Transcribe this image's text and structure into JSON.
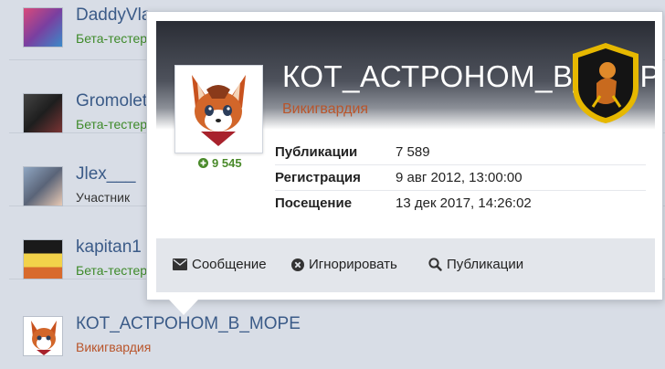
{
  "members": [
    {
      "name": "DaddyVla",
      "rank": "Бета-тестер",
      "rank_type": "beta"
    },
    {
      "name": "Gromolet",
      "rank": "Бета-тестер",
      "rank_type": "beta"
    },
    {
      "name": "Jlex___",
      "rank": "Участник",
      "rank_type": "member"
    },
    {
      "name": "kapitan1",
      "rank": "Бета-тестер",
      "rank_type": "beta"
    },
    {
      "name": "КОТ_АСТРОНОМ_В_МОРЕ",
      "rank": "Викигвардия",
      "rank_type": "viking"
    }
  ],
  "popup": {
    "username": "КОТ_АСТРОНОМ_В_МОРЕ",
    "group": "Викигвардия",
    "reputation": "9 545",
    "stats": [
      {
        "label": "Публикации",
        "value": "7 589"
      },
      {
        "label": "Регистрация",
        "value": "9 авг 2012, 13:00:00"
      },
      {
        "label": "Посещение",
        "value": "13 дек 2017, 14:26:02"
      }
    ],
    "actions": {
      "message": "Сообщение",
      "ignore": "Игнорировать",
      "posts": "Публикации"
    }
  },
  "colors": {
    "link": "#3b5b88",
    "beta": "#3e8a2a",
    "viking": "#b9552b",
    "reputation": "#4a8a2a"
  }
}
